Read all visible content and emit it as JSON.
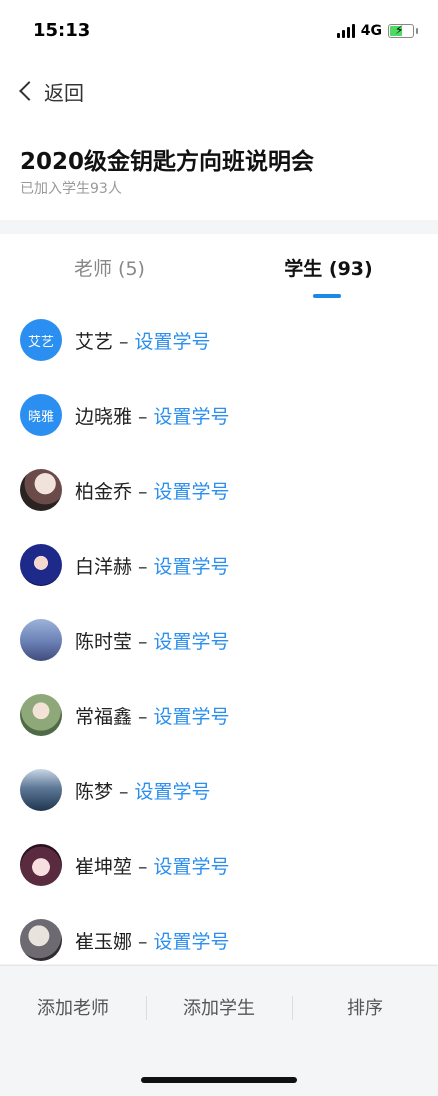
{
  "status": {
    "time": "15:13",
    "network": "4G"
  },
  "nav": {
    "back_label": "返回"
  },
  "header": {
    "title": "2020级金钥匙方向班说明会",
    "subtitle": "已加入学生93人"
  },
  "tabs": {
    "teachers": "老师 (5)",
    "students": "学生 (93)",
    "active": "students"
  },
  "students": [
    {
      "name": "艾艺",
      "avatar_text": "艾艺",
      "action": "设置学号"
    },
    {
      "name": "边晓雅",
      "avatar_text": "晓雅",
      "action": "设置学号"
    },
    {
      "name": "柏金乔",
      "action": "设置学号"
    },
    {
      "name": "白洋赫",
      "action": "设置学号"
    },
    {
      "name": "陈时莹",
      "action": "设置学号"
    },
    {
      "name": "常福鑫",
      "action": "设置学号"
    },
    {
      "name": "陈梦",
      "action": "设置学号"
    },
    {
      "name": "崔坤堃",
      "action": "设置学号"
    },
    {
      "name": "崔玉娜",
      "action": "设置学号"
    }
  ],
  "dash": "–",
  "bottom": {
    "add_teacher": "添加老师",
    "add_student": "添加学生",
    "sort": "排序"
  },
  "colors": {
    "accent": "#2a8ff0",
    "indicator": "#1e88e5"
  }
}
